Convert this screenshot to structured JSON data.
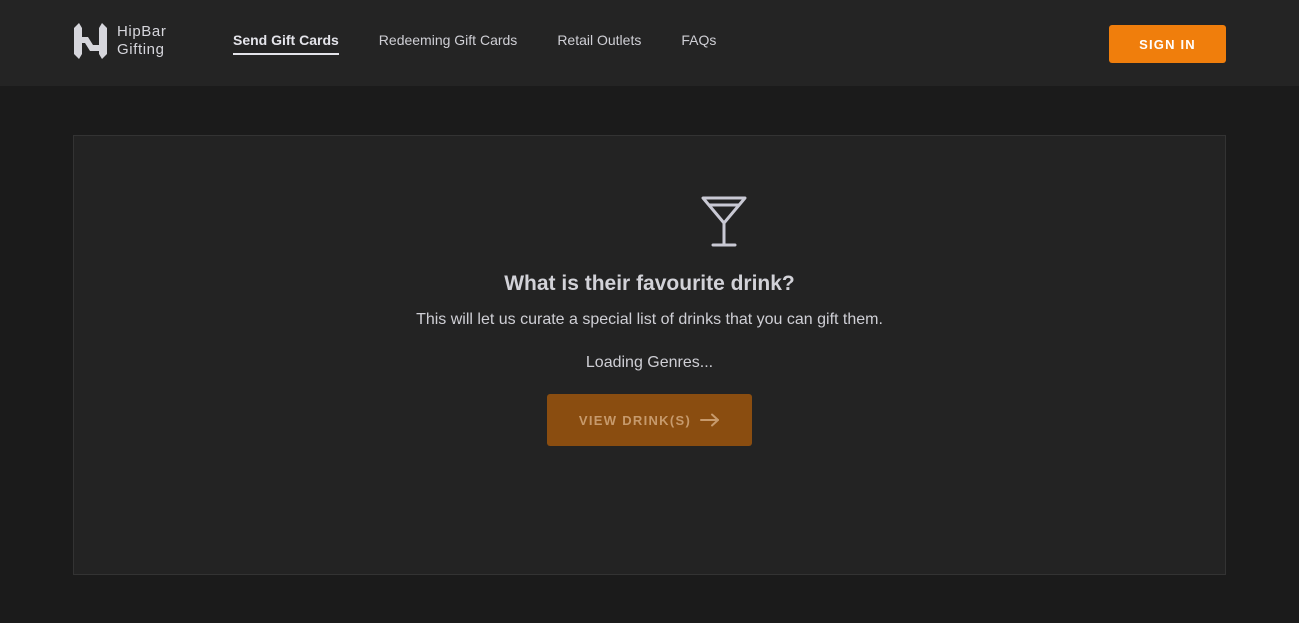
{
  "header": {
    "logo": {
      "line1": "HipBar",
      "line2": "Gifting",
      "icon": "hipbar-h-logo"
    },
    "nav": [
      {
        "label": "Send Gift Cards",
        "active": true
      },
      {
        "label": "Redeeming Gift Cards",
        "active": false
      },
      {
        "label": "Retail Outlets",
        "active": false
      },
      {
        "label": "FAQs",
        "active": false
      }
    ],
    "sign_in_label": "SIGN IN"
  },
  "main": {
    "icon": "martini-glass-icon",
    "title": "What is their favourite drink?",
    "subtitle": "This will let us curate a special list of drinks that you can gift them.",
    "loading_text": "Loading Genres...",
    "view_button_label": "VIEW DRINK(S)",
    "view_button_icon": "arrow-right-icon",
    "view_button_disabled": true
  },
  "colors": {
    "accent": "#f07e0c",
    "accent_disabled": "#8a4d10",
    "background": "#1b1b1b",
    "header_bg": "#242424",
    "panel_bg": "#232323"
  }
}
